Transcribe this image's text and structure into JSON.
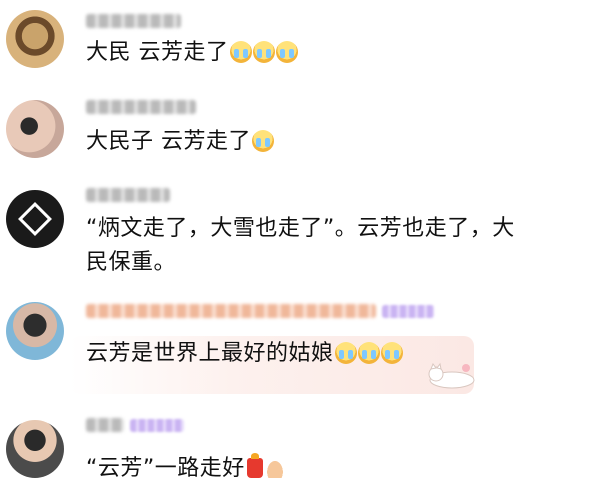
{
  "comments": [
    {
      "text": "大民  云芳走了",
      "emoji_count": 3,
      "emoji_icon": "crying-face-icon"
    },
    {
      "text": "大民子 云芳走了",
      "emoji_count": 1,
      "emoji_icon": "crying-face-icon"
    },
    {
      "text_line1": "“炳文走了，大雪也走了”。云芳也走了，大",
      "text_line2": "民保重。"
    },
    {
      "text": "云芳是世界上最好的姑娘",
      "emoji_count": 3,
      "emoji_icon": "crying-face-icon",
      "highlight_color": "#fbe8e4",
      "sticker_icon": "cat-sticker-icon"
    },
    {
      "text": "“云芳”一路走好",
      "gift_icon": "red-gift-icon",
      "hands_icon": "praying-hands-icon"
    }
  ],
  "colors": {
    "text": "#111111",
    "username_blur": "#b9b9b9",
    "username_blur_orange": "#f0b79a",
    "badge_purple": "#c9b3f2"
  }
}
